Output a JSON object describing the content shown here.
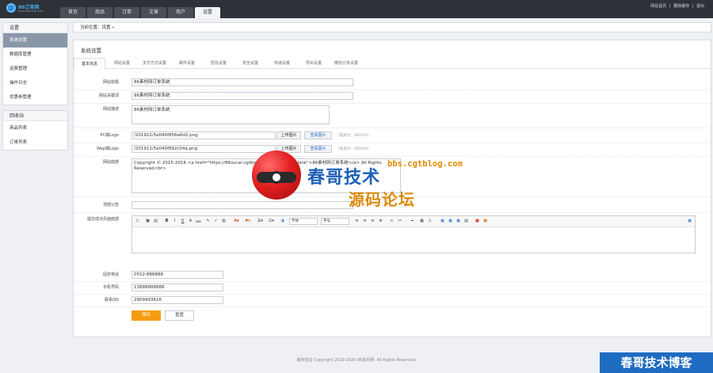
{
  "logo": {
    "name": "86订单网",
    "sub": "www.86sucai.com"
  },
  "nav": {
    "tabs": [
      "首页",
      "商品",
      "订单",
      "文章",
      "用户",
      "设置"
    ],
    "active_index": 5
  },
  "toplinks": [
    "网站首页",
    "|",
    "删除缓存",
    "|",
    "退出"
  ],
  "sidebar": {
    "groups": [
      {
        "title": "设置",
        "items": [
          "系统设置",
          "数据库管理",
          "运费管理",
          "操作日志",
          "优惠券管理"
        ],
        "active": 0
      },
      {
        "title": "回收站",
        "items": [
          "商品列表",
          "订单列表"
        ]
      }
    ]
  },
  "breadcrumb": "当前位置：设置 »",
  "panel": {
    "title": "系统设置",
    "tabs": [
      "基本信息",
      "网站设置",
      "支付方式设置",
      "邮件设置",
      "短信设置",
      "安全设置",
      "快递设置",
      "导出设置",
      "微信分享设置"
    ],
    "active_tab": 0
  },
  "form": {
    "site_title": {
      "label": "网站标题",
      "value": "86素材网订单系统"
    },
    "site_keywords": {
      "label": "网站关键词",
      "value": "86素材网订单系统"
    },
    "site_desc": {
      "label": "网站描述",
      "value": "86素材网订单系统"
    },
    "pc_logo": {
      "label": "PC端Logo",
      "value": "/201912/5e040f856e6d2.png",
      "upload": "上传图片",
      "view": "查看图片",
      "hint": "（宽高为：160X70）"
    },
    "wap_logo": {
      "label": "Wap端Logo",
      "value": "/201912/5e040f892c04a.png",
      "upload": "上传图片",
      "view": "查看图片",
      "hint": "（宽高为：160X40）"
    },
    "site_footer": {
      "label": "网站底部",
      "value": "Copyright © 2015-2018 <a href=\"https://86sucai.cgtblog.com\" target=\"_blank\">86素材网订单系统</a> All Rights Reserved<br>"
    },
    "top_notice": {
      "label": "顶部公告",
      "value": ""
    },
    "submit_success": {
      "label": "提交成功页面底部"
    },
    "editor": {
      "font_select": "字体",
      "size_select": "字号"
    },
    "phone": {
      "label": "固定电话",
      "value": "0552-888888"
    },
    "mobile": {
      "label": "手机号码",
      "value": "13888888888"
    },
    "qq": {
      "label": "联系QQ",
      "value": "2909993616"
    },
    "save": "保存",
    "reset": "重置"
  },
  "footer": "版权信息 Copyright 2019-2020 86素材网. All Rights Reserved.",
  "watermark": {
    "url": "bbs.cgtblog.com",
    "line1": "春哥技术",
    "line2": "源码论坛",
    "corner": "春哥技术博客"
  }
}
